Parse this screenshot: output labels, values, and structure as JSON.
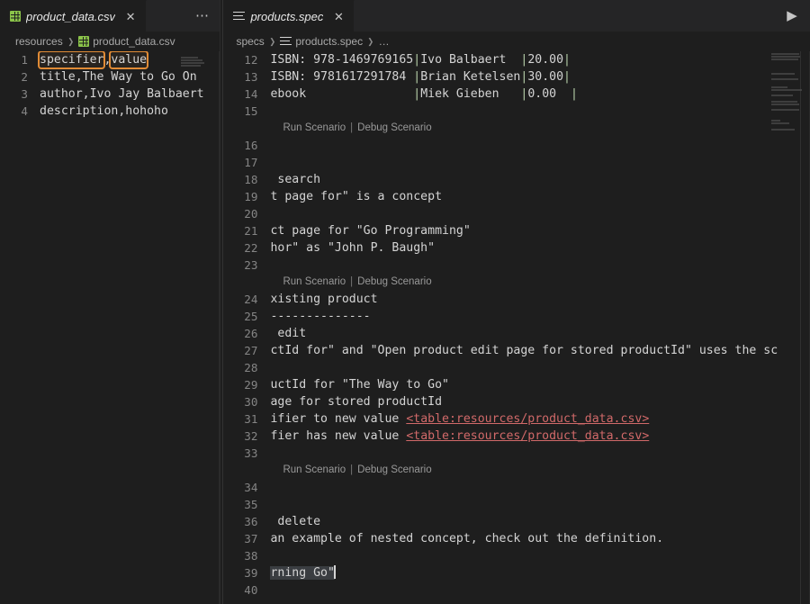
{
  "app": {
    "theme_bg": "#1e1e1e",
    "tabbar_bg": "#252526",
    "accent_highlight": "#e08b36",
    "table_token_color": "#d16969",
    "csv_icon_color": "#8bc34a"
  },
  "left_group": {
    "tab": {
      "label": "product_data.csv",
      "icon": "table-icon",
      "close_label": "✕",
      "active": true
    },
    "actions": [
      {
        "name": "more-actions-button",
        "label": "⋯"
      }
    ],
    "breadcrumbs": [
      {
        "label": "resources",
        "icon": null
      },
      {
        "label": "product_data.csv",
        "icon": "table-icon"
      }
    ],
    "breadcrumb_separator": "❯",
    "lines": [
      {
        "num": "1",
        "text": "specifier,value",
        "highlight": true
      },
      {
        "num": "2",
        "text": "title,The Way to Go On"
      },
      {
        "num": "3",
        "text": "author,Ivo Jay Balbaert"
      },
      {
        "num": "4",
        "text": "description,hohoho"
      }
    ],
    "highlight_tokens": {
      "first": "specifier",
      "separator": ",",
      "second": "value"
    }
  },
  "right_group": {
    "tab": {
      "label": "products.spec",
      "icon": "lines-icon",
      "close_label": "✕",
      "active": true
    },
    "actions": [
      {
        "name": "run-button",
        "label": "▶"
      }
    ],
    "breadcrumbs": [
      {
        "label": "specs",
        "icon": null
      },
      {
        "label": "products.spec",
        "icon": "lines-icon"
      },
      {
        "label": "…",
        "icon": null
      }
    ],
    "breadcrumb_separator": "❯",
    "codelens": {
      "run_label": "Run Scenario",
      "separator": "|",
      "debug_label": "Debug Scenario"
    },
    "lines": [
      {
        "num": "12",
        "type": "code",
        "text": "ISBN: 978-1469769165|Ivo Balbaert  |20.00|"
      },
      {
        "num": "13",
        "type": "code",
        "text": "ISBN: 9781617291784 |Brian Ketelsen|30.00|"
      },
      {
        "num": "14",
        "type": "code",
        "text": "ebook               |Miek Gieben   |0.00  |"
      },
      {
        "num": "15",
        "type": "code",
        "text": ""
      },
      {
        "num": "",
        "type": "codelens"
      },
      {
        "num": "16",
        "type": "code",
        "text": ""
      },
      {
        "num": "17",
        "type": "code",
        "text": ""
      },
      {
        "num": "18",
        "type": "code",
        "text": " search"
      },
      {
        "num": "19",
        "type": "code",
        "text": "t page for\" is a concept"
      },
      {
        "num": "20",
        "type": "code",
        "text": ""
      },
      {
        "num": "21",
        "type": "code",
        "text": "ct page for \"Go Programming\""
      },
      {
        "num": "22",
        "type": "code",
        "text": "hor\" as \"John P. Baugh\""
      },
      {
        "num": "23",
        "type": "code",
        "text": ""
      },
      {
        "num": "",
        "type": "codelens"
      },
      {
        "num": "24",
        "type": "code",
        "text": "xisting product"
      },
      {
        "num": "25",
        "type": "code",
        "text": "--------------"
      },
      {
        "num": "26",
        "type": "code",
        "text": " edit"
      },
      {
        "num": "27",
        "type": "code",
        "text": "ctId for\" and \"Open product edit page for stored productId\" uses the sc"
      },
      {
        "num": "28",
        "type": "code",
        "text": ""
      },
      {
        "num": "29",
        "type": "code",
        "text": "uctId for \"The Way to Go\""
      },
      {
        "num": "30",
        "type": "code",
        "text": "age for stored productId"
      },
      {
        "num": "31",
        "type": "table",
        "prefix": "ifier to new value ",
        "token": "<table:resources/product_data.csv>"
      },
      {
        "num": "32",
        "type": "table",
        "prefix": "fier has new value ",
        "token": "<table:resources/product_data.csv>"
      },
      {
        "num": "33",
        "type": "code",
        "text": ""
      },
      {
        "num": "",
        "type": "codelens"
      },
      {
        "num": "34",
        "type": "code",
        "text": ""
      },
      {
        "num": "35",
        "type": "code",
        "text": ""
      },
      {
        "num": "36",
        "type": "code",
        "text": " delete"
      },
      {
        "num": "37",
        "type": "code",
        "text": "an example of nested concept, check out the definition."
      },
      {
        "num": "38",
        "type": "code",
        "text": ""
      },
      {
        "num": "39",
        "type": "selection",
        "text": "rning Go\""
      },
      {
        "num": "40",
        "type": "code",
        "text": ""
      }
    ]
  }
}
